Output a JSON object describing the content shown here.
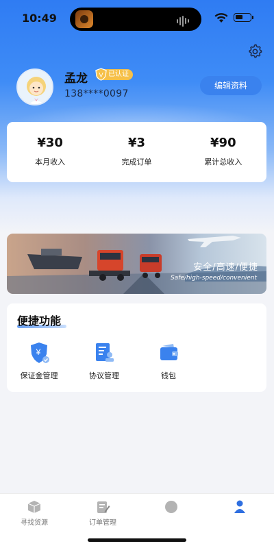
{
  "status_bar": {
    "time": "10:49"
  },
  "profile": {
    "name": "孟龙",
    "verified_label": "已认证",
    "verified_mark": "V",
    "phone": "138****0097",
    "edit_button": "编辑资料"
  },
  "stats": [
    {
      "value": "¥30",
      "label": "本月收入"
    },
    {
      "value": "¥3",
      "label": "完成订单"
    },
    {
      "value": "¥90",
      "label": "累计总收入"
    }
  ],
  "banner": {
    "title": "安全/高速/便捷",
    "subtitle": "Safe/high-speed/convenient"
  },
  "quick_functions": {
    "title": "便捷功能",
    "items": [
      {
        "label": "保证金管理",
        "icon": "deposit-shield-icon",
        "glyph": "¥"
      },
      {
        "label": "协议管理",
        "icon": "agreement-icon"
      },
      {
        "label": "钱包",
        "icon": "wallet-icon"
      }
    ]
  },
  "tab_bar": {
    "tabs": [
      {
        "label": "寻找货源",
        "icon": "cargo-box-icon",
        "active": false
      },
      {
        "label": "订单管理",
        "icon": "order-edit-icon",
        "active": false
      },
      {
        "label": "",
        "icon": "message-icon",
        "active": false
      },
      {
        "label": "",
        "icon": "user-icon",
        "active": true
      }
    ]
  },
  "colors": {
    "primary": "#3a82ee",
    "badge": "#f6c049",
    "hero_top": "#2f7cf3"
  }
}
